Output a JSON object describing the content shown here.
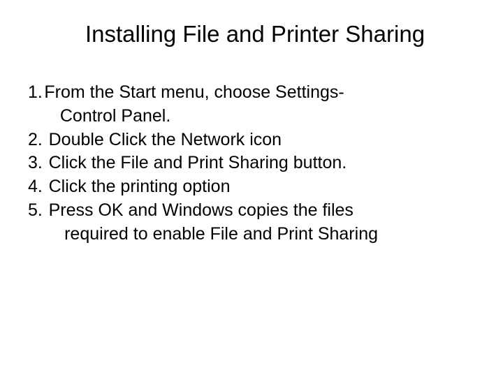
{
  "title": "Installing File and Printer Sharing",
  "steps": {
    "s1": {
      "num": "1.",
      "line1": "From the Start menu, choose Settings-",
      "line2": "Control Panel."
    },
    "s2": {
      "num": "2.",
      "text": "Double Click the Network icon"
    },
    "s3": {
      "num": "3.",
      "text": "Click the File and Print Sharing button."
    },
    "s4": {
      "num": "4.",
      "text": "Click the printing option"
    },
    "s5": {
      "num": "5.",
      "line1": "Press OK and Windows copies the files",
      "line2": "required to enable File and Print Sharing"
    }
  }
}
